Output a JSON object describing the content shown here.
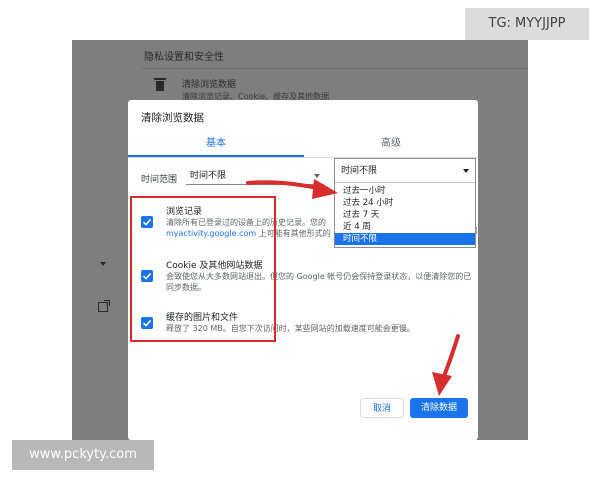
{
  "background": {
    "section_title": "隐私设置和安全性",
    "row_title": "清除浏览数据",
    "row_subtitle": "清除浏览记录、Cookie、缓存及其他数据"
  },
  "dialog": {
    "title": "清除浏览数据",
    "tabs": [
      "基本",
      "高级"
    ],
    "active_tab": "基本",
    "time_range_label": "时间范围",
    "time_range_value": "时间不限",
    "options": [
      {
        "title": "浏览记录",
        "desc_line1": "清除所有已登录过的设备上的历史记录。您的",
        "desc_line2_link": "myactivity.google.com",
        "desc_line2_rest": " 上可能有其他形式的",
        "checked": true
      },
      {
        "title": "Cookie 及其他网站数据",
        "description": "会致使您从大多数网站退出。但您的 Google 帐号仍会保持登录状态，以便清除您的已同步数据。",
        "checked": true
      },
      {
        "title": "缓存的图片和文件",
        "description": "释放了 320 MB。自您下次访问时，某些网站的加载速度可能会更慢。",
        "checked": true
      }
    ],
    "cancel_label": "取消",
    "clear_label": "清除数据"
  },
  "dropdown": {
    "current": "时间不限",
    "items": [
      "过去一小时",
      "过去 24 小时",
      "过去 7 天",
      "近 4 周",
      "时间不限"
    ],
    "selected_index": 4,
    "peek_text": "出"
  },
  "watermarks": {
    "top_right": "TG: MYYJJPP",
    "bottom_left": "www.pckyty.com"
  },
  "colors": {
    "accent": "#1a73e8",
    "annotation_red": "#d92c2c",
    "overlay_gray": "#7e7e7e"
  }
}
